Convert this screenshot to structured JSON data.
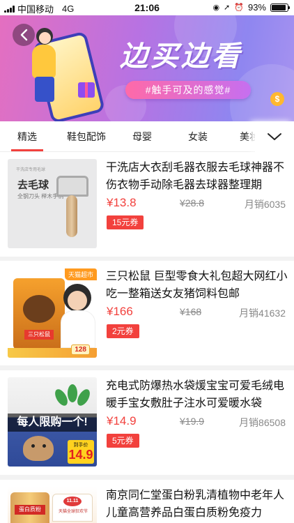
{
  "status_bar": {
    "carrier": "中国移动",
    "network": "4G",
    "time": "21:06",
    "battery_percent": "93%",
    "battery_level": 0.93
  },
  "banner": {
    "title": "边买边看",
    "slogan": "#触手可及的感觉#",
    "coin_symbol": "$",
    "icons": [
      "back-arrow-icon",
      "phone-shopper-illustration",
      "gift-box-icon",
      "coin-icon"
    ]
  },
  "tabs": {
    "items": [
      {
        "label": "精选",
        "active": true
      },
      {
        "label": "鞋包配饰",
        "active": false
      },
      {
        "label": "母婴",
        "active": false
      },
      {
        "label": "女装",
        "active": false
      },
      {
        "label": "美妆",
        "active": false
      }
    ],
    "more_icon": "chevron-down-icon",
    "accent_color": "#f2413d"
  },
  "products": [
    {
      "title": "干洗店大衣刮毛器衣服去毛球神器不伤衣物手动除毛器去球器整理期",
      "price": "¥13.8",
      "original_price": "¥28.8",
      "monthly_sales": "月销6035",
      "coupon": "15元券",
      "image": {
        "header": "干洗店专用毛球",
        "title": "去毛球",
        "subtitle": "全钢刀头  榉木手柄"
      }
    },
    {
      "title": "三只松鼠 巨型零食大礼包超大网红小吃一整箱送女友猪饲料包邮",
      "price": "¥166",
      "original_price": "¥168",
      "monthly_sales": "月销41632",
      "coupon": "2元券",
      "image": {
        "tag": "天猫超市",
        "bag_label": "三只松鼠",
        "price_tag": "128"
      }
    },
    {
      "title": "充电式防爆热水袋煖宝宝可爱毛绒电暖手宝女敷肚子注水可爱暖水袋",
      "price": "¥14.9",
      "original_price": "¥19.9",
      "monthly_sales": "月销86508",
      "coupon": "5元券",
      "image": {
        "banner": "每人限购一个!",
        "price_label": "到手价",
        "price_value": "14.9"
      }
    },
    {
      "title": "南京同仁堂蛋白粉乳清植物中老年人儿童高营养品白蛋白质粉免疫力",
      "image": {
        "can_label": "蛋白质粉",
        "logo": "11.11",
        "logo_text": "天猫全球狂欢节"
      }
    }
  ],
  "colors": {
    "price_red": "#f2413d",
    "banner_gradient_start": "#e46fc0",
    "banner_gradient_end": "#8f86f0"
  }
}
